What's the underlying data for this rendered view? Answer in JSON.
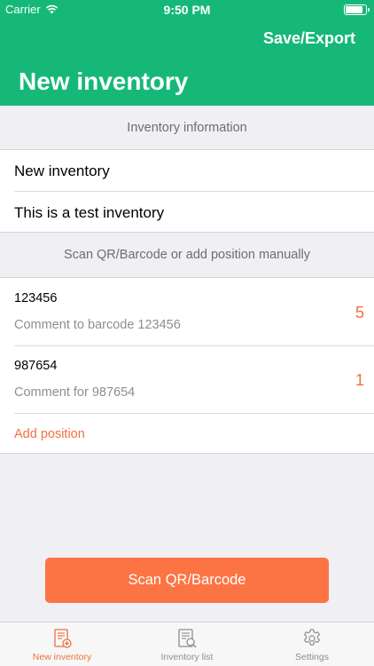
{
  "status_bar": {
    "carrier": "Carrier",
    "time": "9:50 PM"
  },
  "nav": {
    "action": "Save/Export",
    "title": "New inventory"
  },
  "info_section": {
    "header": "Inventory information",
    "name_value": "New inventory",
    "description_value": "This is a test inventory"
  },
  "positions_section": {
    "header": "Scan QR/Barcode or add position manually",
    "items": [
      {
        "code": "123456",
        "comment": "Comment to barcode 123456",
        "quantity": "5"
      },
      {
        "code": "987654",
        "comment": "Comment for 987654",
        "quantity": "1"
      }
    ],
    "add_label": "Add position"
  },
  "scan_button": {
    "label": "Scan QR/Barcode"
  },
  "tabs": [
    {
      "label": "New inventory",
      "icon": "new-inventory-icon",
      "active": true
    },
    {
      "label": "Inventory list",
      "icon": "inventory-list-icon",
      "active": false
    },
    {
      "label": "Settings",
      "icon": "gear-icon",
      "active": false
    }
  ],
  "colors": {
    "brand": "#16b877",
    "accent": "#f07040",
    "button": "#fc7443"
  }
}
